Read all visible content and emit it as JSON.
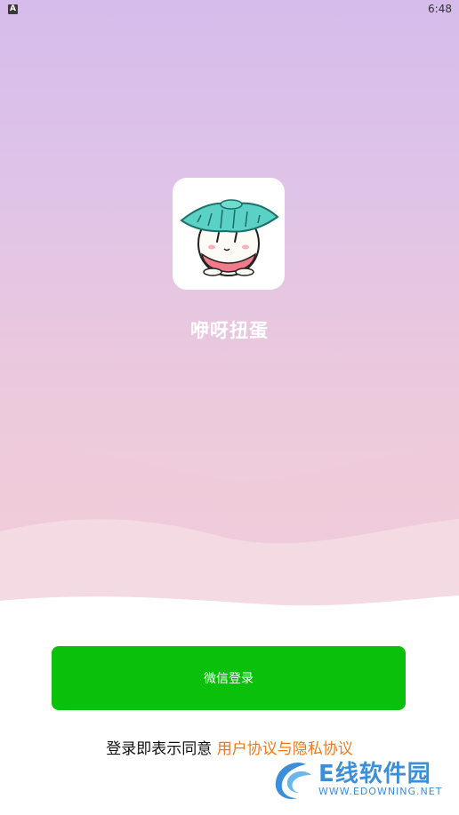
{
  "status_bar": {
    "indicator_letter": "A",
    "time": "6:48"
  },
  "app": {
    "icon": "cartoon-egg-mascot-icon",
    "name": "咿呀扭蛋"
  },
  "login": {
    "wechat_button_label": "微信登录"
  },
  "agreement": {
    "prefix": "登录即表示同意 ",
    "links_label": "用户协议与隐私协议"
  },
  "watermark": {
    "brand": "E线软件园",
    "url": "WWW.EDOWNING.NET"
  },
  "colors": {
    "wechat_green": "#0ac00a",
    "link_orange": "#ee7a1a",
    "watermark_blue": "#3a8fd8"
  }
}
